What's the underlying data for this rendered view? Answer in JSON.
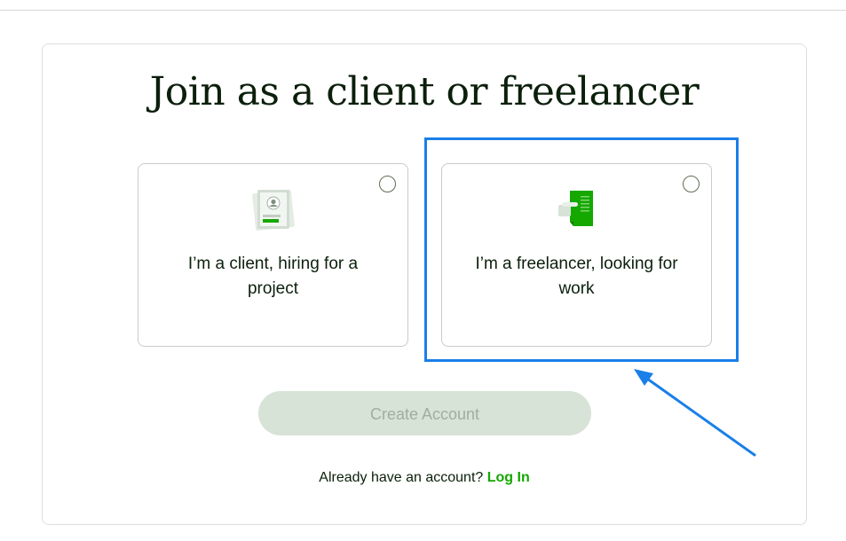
{
  "page": {
    "title": "Join as a client or freelancer"
  },
  "options": {
    "client": {
      "label": "I’m a client, hiring for a project",
      "icon": "client-profile-icon",
      "selected": false
    },
    "freelancer": {
      "label": "I’m a freelancer, looking for work",
      "icon": "freelancer-document-icon",
      "selected": false
    }
  },
  "actions": {
    "create_account_label": "Create Account",
    "create_account_enabled": false
  },
  "login": {
    "prompt": "Already have an account?",
    "link_label": "Log In"
  },
  "colors": {
    "brand_green": "#14a800",
    "title_text": "#0b1f0b",
    "button_disabled_bg": "#d7e3d7",
    "button_disabled_text": "#9fae9f",
    "annotation_blue": "#1a7fe8"
  }
}
